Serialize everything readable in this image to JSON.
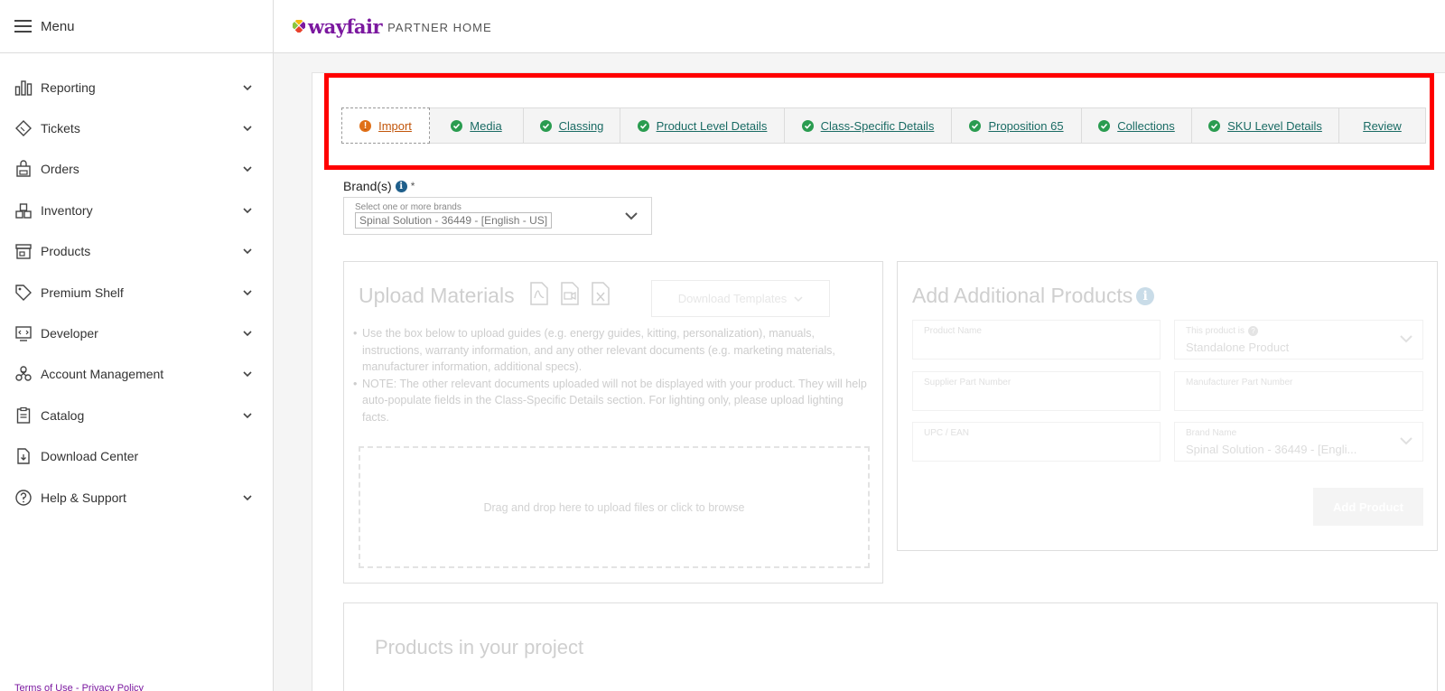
{
  "menu": {
    "label": "Menu"
  },
  "brand": {
    "logo": "wayfair",
    "subtitle": "PARTNER HOME"
  },
  "sidebar": {
    "items": [
      {
        "label": "Reporting",
        "icon": "bar-chart-icon",
        "expandable": true
      },
      {
        "label": "Tickets",
        "icon": "ticket-icon",
        "expandable": true
      },
      {
        "label": "Orders",
        "icon": "shopping-bag-icon",
        "expandable": true
      },
      {
        "label": "Inventory",
        "icon": "boxes-icon",
        "expandable": true
      },
      {
        "label": "Products",
        "icon": "storefront-icon",
        "expandable": true
      },
      {
        "label": "Premium Shelf",
        "icon": "tag-icon",
        "expandable": true
      },
      {
        "label": "Developer",
        "icon": "code-screen-icon",
        "expandable": true
      },
      {
        "label": "Account Management",
        "icon": "network-icon",
        "expandable": true
      },
      {
        "label": "Catalog",
        "icon": "clipboard-icon",
        "expandable": true
      },
      {
        "label": "Download Center",
        "icon": "download-file-icon",
        "expandable": false
      },
      {
        "label": "Help & Support",
        "icon": "help-circle-icon",
        "expandable": true
      }
    ],
    "footer": {
      "terms": "Terms of Use",
      "separator": " - ",
      "privacy": "Privacy Policy"
    }
  },
  "tabs": [
    {
      "label": "Import",
      "status": "warning",
      "width": 98
    },
    {
      "label": "Media",
      "status": "complete",
      "width": 104
    },
    {
      "label": "Classing",
      "status": "complete",
      "width": 107
    },
    {
      "label": "Product Level Details",
      "status": "complete",
      "width": 182
    },
    {
      "label": "Class-Specific Details",
      "status": "complete",
      "width": 185
    },
    {
      "label": "Proposition 65",
      "status": "complete",
      "width": 144
    },
    {
      "label": "Collections",
      "status": "complete",
      "width": 122
    },
    {
      "label": "SKU Level Details",
      "status": "complete",
      "width": 163
    },
    {
      "label": "Review",
      "status": "none",
      "width": 96
    }
  ],
  "brands_field": {
    "label": "Brand(s)",
    "required": "*",
    "placeholder": "Select one or more brands",
    "value": "Spinal Solution - 36449 - [English - US]"
  },
  "upload": {
    "title": "Upload Materials",
    "download_button": "Download Templates",
    "bullets": [
      "Use the box below to upload guides (e.g. energy guides, kitting, personalization), manuals, instructions, warranty information, and any other relevant documents (e.g. marketing materials, manufacturer information, additional specs).",
      "NOTE: The other relevant documents uploaded will not be displayed with your product. They will help auto-populate fields in the Class-Specific Details section. For lighting only, please upload lighting facts."
    ],
    "dropzone": "Drag and drop here to upload files or click to browse"
  },
  "add_products": {
    "title": "Add Additional Products",
    "fields": {
      "product_name": {
        "label": "Product Name",
        "value": ""
      },
      "product_type": {
        "label": "This product is",
        "value": "Standalone Product"
      },
      "supplier_part": {
        "label": "Supplier Part Number",
        "value": ""
      },
      "manufacturer_part": {
        "label": "Manufacturer Part Number",
        "value": ""
      },
      "upc": {
        "label": "UPC / EAN",
        "value": ""
      },
      "brand_name": {
        "label": "Brand Name",
        "value": "Spinal Solution - 36449 - [Engli..."
      }
    },
    "button": "Add Product"
  },
  "projects": {
    "title": "Products in your project"
  }
}
